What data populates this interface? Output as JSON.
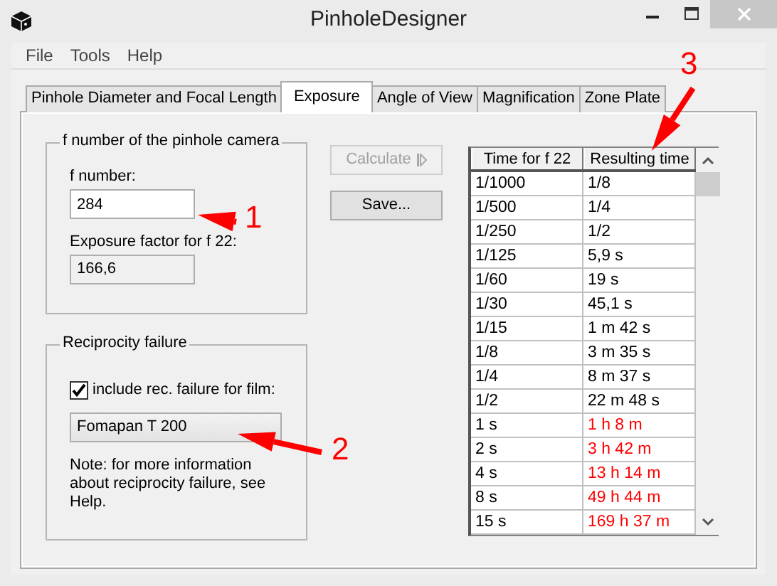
{
  "window": {
    "title": "PinholeDesigner"
  },
  "menu": [
    "File",
    "Tools",
    "Help"
  ],
  "tabs": [
    {
      "label": "Pinhole Diameter and Focal Length",
      "selected": false
    },
    {
      "label": "Exposure",
      "selected": true
    },
    {
      "label": "Angle of View",
      "selected": false
    },
    {
      "label": "Magnification",
      "selected": false
    },
    {
      "label": "Zone Plate",
      "selected": false
    }
  ],
  "fnumber_group": {
    "title": "f number of the pinhole camera",
    "fnumber_label": "f number:",
    "fnumber_value": "284",
    "factor_label": "Exposure factor for f 22:",
    "factor_value": "166,6"
  },
  "reciprocity_group": {
    "title": "Reciprocity failure",
    "checkbox_label": "include rec. failure for film:",
    "checked": true,
    "film": "Fomapan T 200",
    "note": "Note: for more information about reciprocity failure, see Help."
  },
  "buttons": [
    {
      "label": "Calculate",
      "disabled": true
    },
    {
      "label": "Save...",
      "disabled": false
    }
  ],
  "table": {
    "columns": [
      "Time for f 22",
      "Resulting time"
    ],
    "rows": [
      {
        "cells": [
          "1/1000",
          "1/8"
        ],
        "color": "#000000"
      },
      {
        "cells": [
          "1/500",
          "1/4"
        ],
        "color": "#000000"
      },
      {
        "cells": [
          "1/250",
          "1/2"
        ],
        "color": "#000000"
      },
      {
        "cells": [
          "1/125",
          "5,9 s"
        ],
        "color": "#000000"
      },
      {
        "cells": [
          "1/60",
          "19 s"
        ],
        "color": "#000000"
      },
      {
        "cells": [
          "1/30",
          "45,1 s"
        ],
        "color": "#000000"
      },
      {
        "cells": [
          "1/15",
          "1 m 42 s"
        ],
        "color": "#000000"
      },
      {
        "cells": [
          "1/8",
          "3 m 35 s"
        ],
        "color": "#000000"
      },
      {
        "cells": [
          "1/4",
          "8 m 37 s"
        ],
        "color": "#000000"
      },
      {
        "cells": [
          "1/2",
          "22 m 48 s"
        ],
        "color": "#000000"
      },
      {
        "cells": [
          "1 s",
          "1 h 8 m"
        ],
        "color": "#ff0000"
      },
      {
        "cells": [
          "2 s",
          "3 h 42 m"
        ],
        "color": "#ff0000"
      },
      {
        "cells": [
          "4 s",
          "13 h 14 m"
        ],
        "color": "#ff0000"
      },
      {
        "cells": [
          "8 s",
          "49 h 44 m"
        ],
        "color": "#ff0000"
      },
      {
        "cells": [
          "15 s",
          "169 h 37 m"
        ],
        "color": "#ff0000"
      }
    ]
  },
  "annotations": [
    {
      "label": "1"
    },
    {
      "label": "2"
    },
    {
      "label": "3"
    }
  ]
}
